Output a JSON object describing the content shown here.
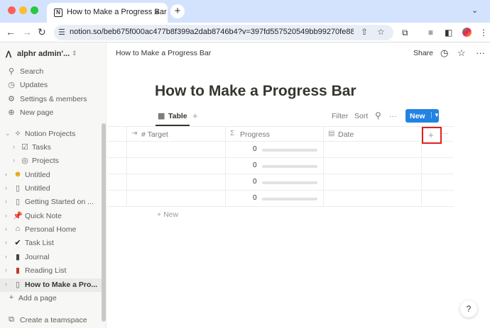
{
  "browser": {
    "tab_title": "How to Make a Progress Bar",
    "url": "notion.so/beb675f000ac477b8f399a2dab8746b4?v=397fd557520549bb99270fe88c...",
    "close_glyph": "✕",
    "newtab_glyph": "+"
  },
  "sidebar": {
    "workspace": "alphr admin'...",
    "nav": [
      {
        "label": "Search",
        "icon": "search-icon"
      },
      {
        "label": "Updates",
        "icon": "clock-icon"
      },
      {
        "label": "Settings & members",
        "icon": "gear-icon"
      },
      {
        "label": "New page",
        "icon": "plus-circle-icon"
      }
    ],
    "pages": [
      {
        "label": "Notion Projects",
        "icon": "sparkle-icon"
      },
      {
        "label": "Tasks",
        "icon": "checkbox-icon"
      },
      {
        "label": "Projects",
        "icon": "target-icon"
      },
      {
        "label": "Untitled",
        "icon": "smile-emoji"
      },
      {
        "label": "Untitled",
        "icon": "page-icon"
      },
      {
        "label": "Getting Started on ...",
        "icon": "page-icon"
      },
      {
        "label": "Quick Note",
        "icon": "pin-emoji"
      },
      {
        "label": "Personal Home",
        "icon": "house-emoji"
      },
      {
        "label": "Task List",
        "icon": "check-emoji"
      },
      {
        "label": "Journal",
        "icon": "notebook-emoji"
      },
      {
        "label": "Reading List",
        "icon": "book-emoji"
      },
      {
        "label": "How to Make a Pro...",
        "icon": "page-icon"
      }
    ],
    "add_page": "Add a page",
    "create_teamspace": "Create a teamspace"
  },
  "header": {
    "breadcrumb": "How to Make a Progress Bar",
    "share": "Share"
  },
  "page": {
    "title": "How to Make a Progress Bar"
  },
  "view": {
    "tab_label": "Table",
    "filter": "Filter",
    "sort": "Sort",
    "more": "···",
    "new_button": "New"
  },
  "table": {
    "columns": [
      {
        "label": "# Target",
        "icon": "arrow-to-bar-icon"
      },
      {
        "label": "Progress",
        "icon": "sigma-icon"
      },
      {
        "label": "Date",
        "icon": "calendar-icon"
      }
    ],
    "rows": [
      {
        "progress": "0",
        "fill": 0
      },
      {
        "progress": "0",
        "fill": 0
      },
      {
        "progress": "0",
        "fill": 0
      },
      {
        "progress": "0",
        "fill": 0
      }
    ],
    "add_row": "New",
    "add_column_glyph": "+",
    "more_glyph": "···"
  },
  "help": "?"
}
